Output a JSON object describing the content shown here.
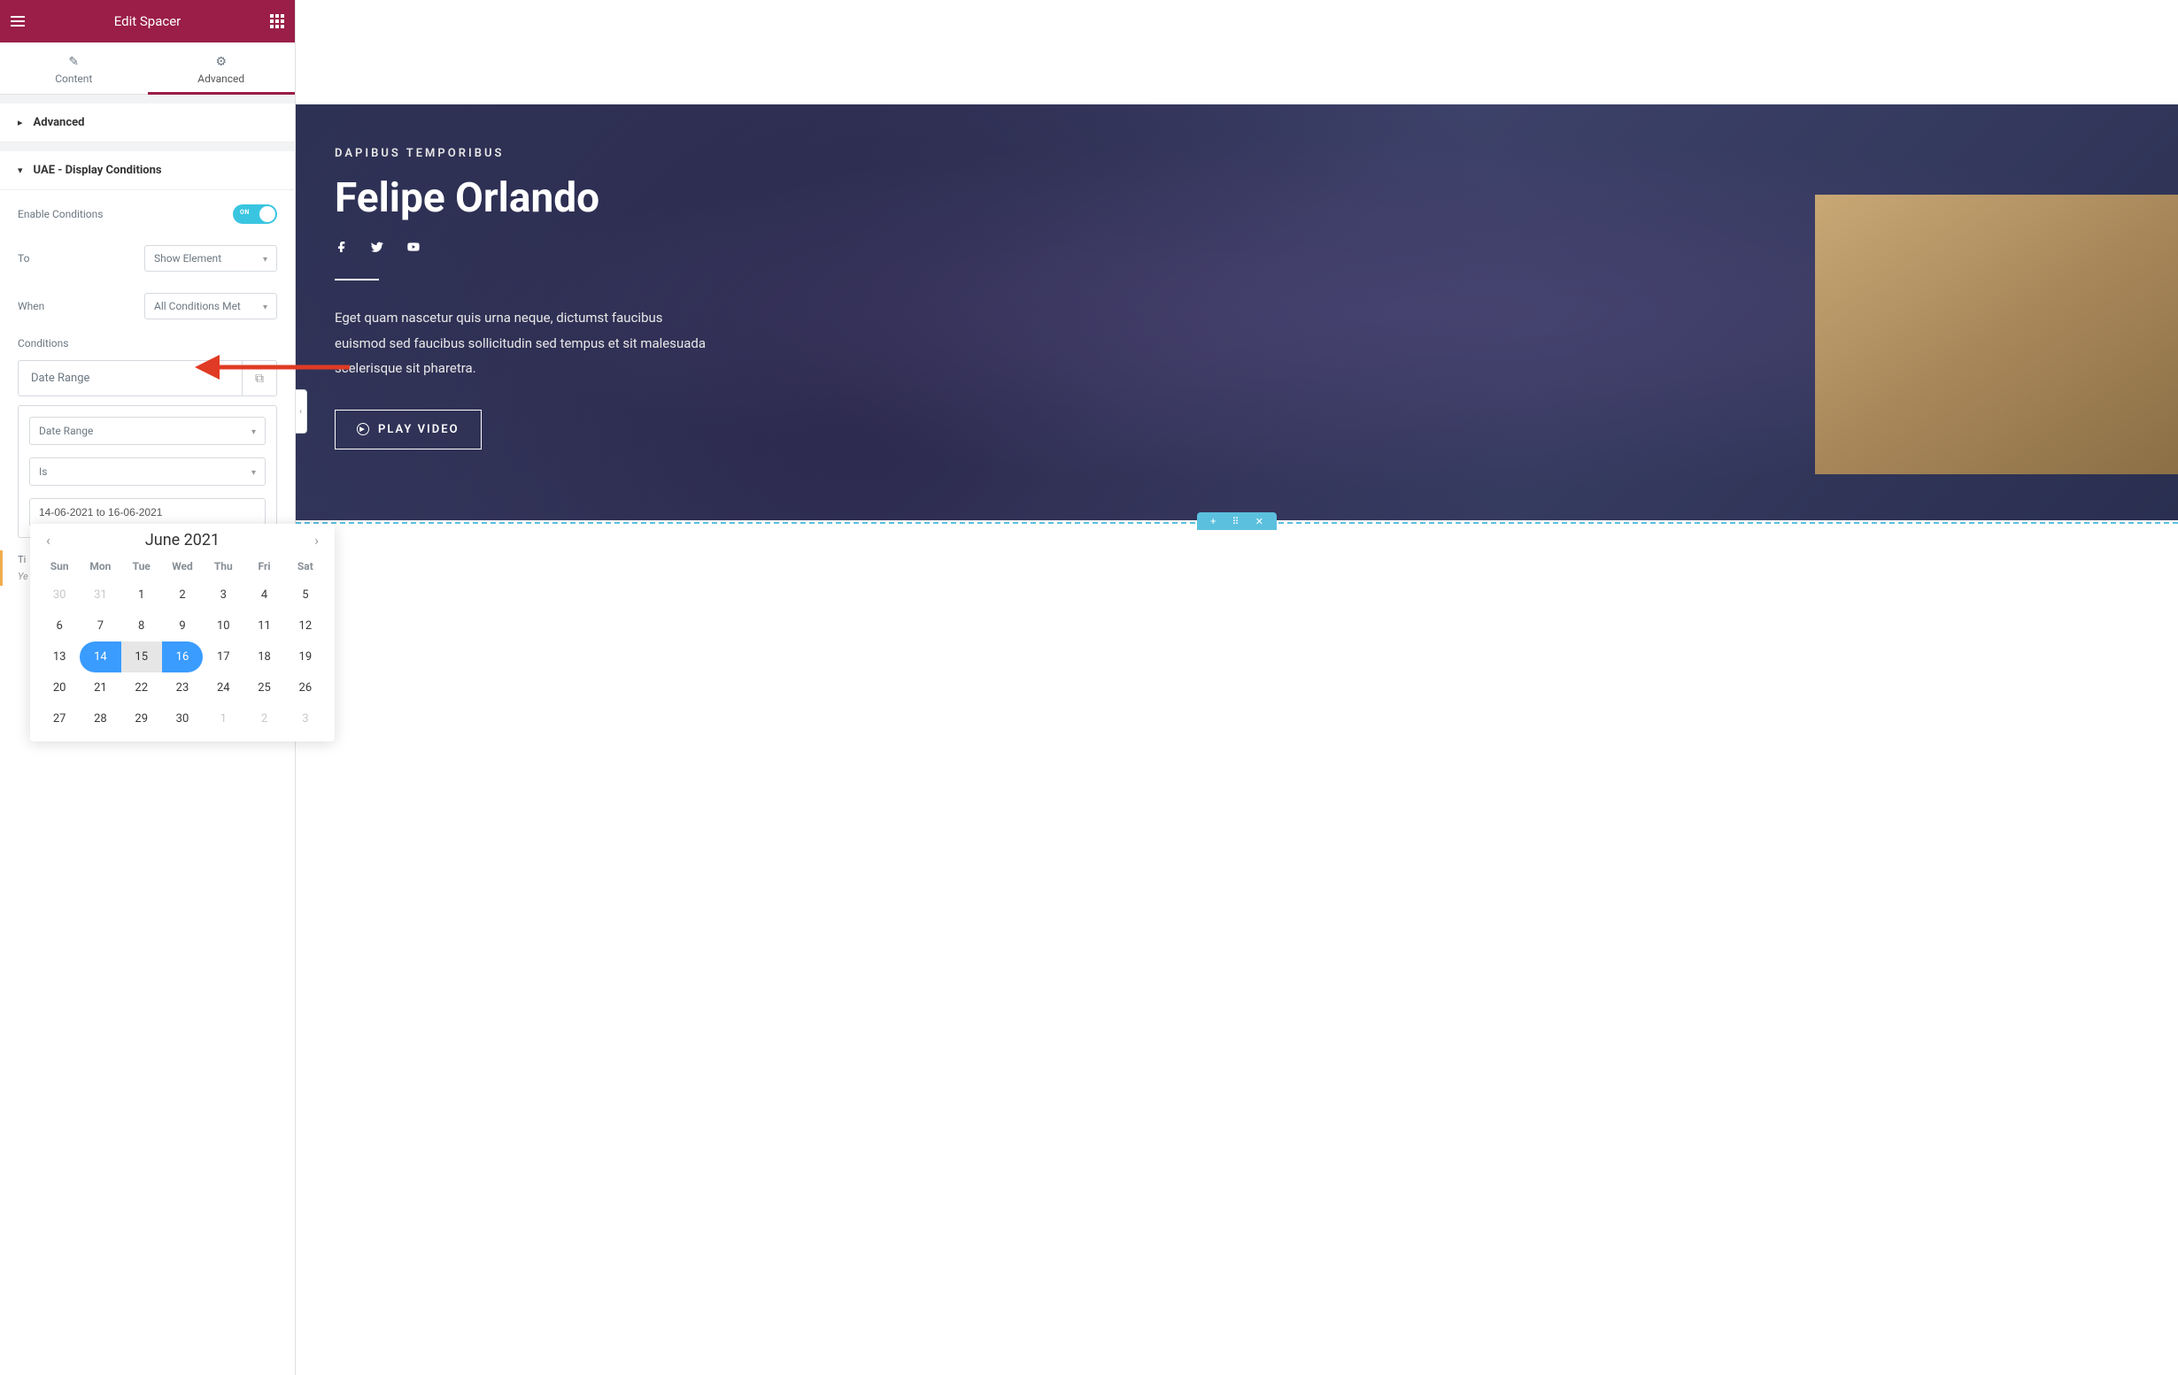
{
  "sidebar": {
    "title": "Edit Spacer",
    "tabs": {
      "content": "Content",
      "advanced": "Advanced",
      "active": "advanced"
    },
    "sections": {
      "advanced": "Advanced",
      "display_conditions": "UAE - Display Conditions"
    },
    "fields": {
      "enable_label": "Enable Conditions",
      "enable_state": "ON",
      "to_label": "To",
      "to_value": "Show Element",
      "when_label": "When",
      "when_value": "All Conditions Met",
      "conditions_label": "Conditions"
    },
    "condition": {
      "header": "Date Range",
      "type": "Date Range",
      "operator": "Is",
      "value": "14-06-2021 to 16-06-2021"
    },
    "timezone_label": "Ti",
    "timezone_hint": "Ye tir"
  },
  "calendar": {
    "month": "June 2021",
    "dow": [
      "Sun",
      "Mon",
      "Tue",
      "Wed",
      "Thu",
      "Fri",
      "Sat"
    ],
    "weeks": [
      [
        {
          "d": "30",
          "t": "prev"
        },
        {
          "d": "31",
          "t": "prev"
        },
        {
          "d": "1"
        },
        {
          "d": "2"
        },
        {
          "d": "3"
        },
        {
          "d": "4"
        },
        {
          "d": "5"
        }
      ],
      [
        {
          "d": "6"
        },
        {
          "d": "7"
        },
        {
          "d": "8"
        },
        {
          "d": "9"
        },
        {
          "d": "10"
        },
        {
          "d": "11"
        },
        {
          "d": "12"
        }
      ],
      [
        {
          "d": "13"
        },
        {
          "d": "14",
          "t": "range-start"
        },
        {
          "d": "15",
          "t": "range-mid"
        },
        {
          "d": "16",
          "t": "range-end"
        },
        {
          "d": "17"
        },
        {
          "d": "18"
        },
        {
          "d": "19"
        }
      ],
      [
        {
          "d": "20"
        },
        {
          "d": "21"
        },
        {
          "d": "22"
        },
        {
          "d": "23"
        },
        {
          "d": "24"
        },
        {
          "d": "25"
        },
        {
          "d": "26"
        }
      ],
      [
        {
          "d": "27"
        },
        {
          "d": "28"
        },
        {
          "d": "29"
        },
        {
          "d": "30"
        },
        {
          "d": "1",
          "t": "next"
        },
        {
          "d": "2",
          "t": "next"
        },
        {
          "d": "3",
          "t": "next"
        }
      ]
    ]
  },
  "preview": {
    "preheading": "DAPIBUS TEMPORIBUS",
    "heading": "Felipe Orlando",
    "description": "Eget quam nascetur quis urna neque, dictumst faucibus euismod sed faucibus sollicitudin sed tempus et sit malesuada scelerisque sit pharetra.",
    "button": "PLAY VIDEO"
  }
}
